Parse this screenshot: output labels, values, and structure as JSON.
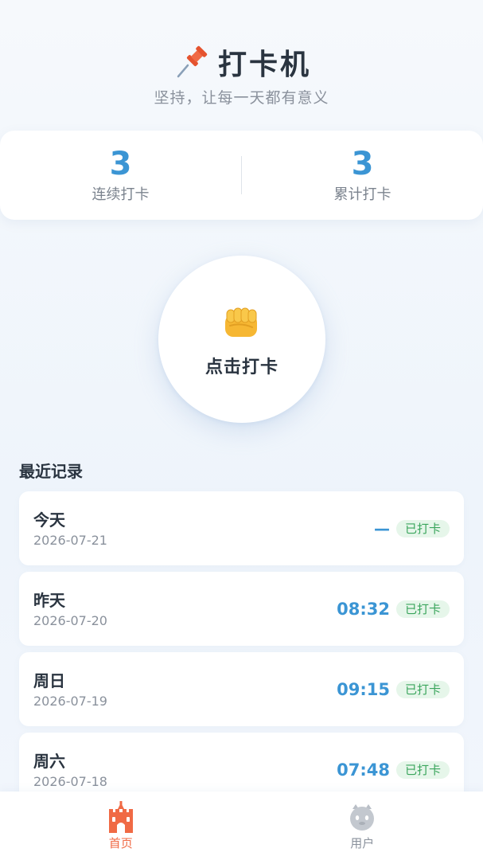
{
  "header": {
    "title": "打卡机",
    "subtitle": "坚持，让每一天都有意义",
    "icon": "pushpin-icon"
  },
  "stats": {
    "streak_value": "3",
    "streak_label": "连续打卡",
    "total_value": "3",
    "total_label": "累计打卡"
  },
  "checkin": {
    "icon": "fist-icon",
    "label": "点击打卡"
  },
  "recent": {
    "title": "最近记录",
    "records": [
      {
        "day": "今天",
        "date": "2026-07-21",
        "time": "—",
        "status": "已打卡"
      },
      {
        "day": "昨天",
        "date": "2026-07-20",
        "time": "08:32",
        "status": "已打卡"
      },
      {
        "day": "周日",
        "date": "2026-07-19",
        "time": "09:15",
        "status": "已打卡"
      },
      {
        "day": "周六",
        "date": "2026-07-18",
        "time": "07:48",
        "status": "已打卡"
      }
    ]
  },
  "nav": {
    "items": [
      {
        "label": "首页",
        "icon": "castle-icon",
        "active": true
      },
      {
        "label": "用户",
        "icon": "user-avatar-icon",
        "active": false
      }
    ]
  },
  "colors": {
    "accent": "#3b95d4",
    "active_nav": "#f06a45",
    "badge_bg": "#e6f6ea",
    "badge_text": "#3aa55c"
  }
}
